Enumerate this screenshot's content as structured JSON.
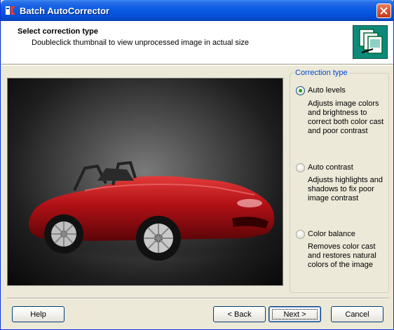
{
  "window": {
    "title": "Batch AutoCorrector"
  },
  "header": {
    "title": "Select correction type",
    "subtitle": "Doubleclick thumbnail to view unprocessed image in actual size"
  },
  "group": {
    "legend": "Correction type",
    "options": [
      {
        "label": "Auto levels",
        "checked": true,
        "description": "Adjusts image colors and brightness to correct both color cast and poor contrast"
      },
      {
        "label": "Auto contrast",
        "checked": false,
        "description": "Adjusts highlights and shadows to fix poor image contrast"
      },
      {
        "label": "Color balance",
        "checked": false,
        "description": "Removes color cast and restores natural colors of the image"
      }
    ]
  },
  "buttons": {
    "help": "Help",
    "back": "< Back",
    "next": "Next >",
    "cancel": "Cancel"
  },
  "colors": {
    "titlebar": "#0a5ae3",
    "accent_legend": "#0046d5",
    "car": "#b01015"
  }
}
